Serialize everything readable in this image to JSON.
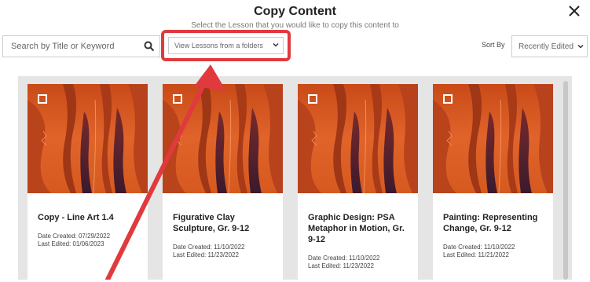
{
  "dialog": {
    "title": "Copy Content",
    "subtitle": "Select the Lesson that you would like to copy this content to"
  },
  "search": {
    "placeholder": "Search by Title or Keyword"
  },
  "folder_select": {
    "value": "View Lessons from a folders"
  },
  "sort": {
    "label": "Sort By",
    "value": "Recently Edited"
  },
  "colors": {
    "annotation_red": "#e03a3e",
    "panel_gray": "#e5e5e5",
    "painting_orange": "#d2571f"
  },
  "cards": [
    {
      "title": "Copy - Line Art 1.4",
      "created": "Date Created: 07/29/2022",
      "edited": "Last Edited: 01/06/2023"
    },
    {
      "title": "Figurative Clay Sculpture, Gr. 9-12",
      "created": "Date Created: 11/10/2022",
      "edited": "Last Edited: 11/23/2022"
    },
    {
      "title": "Graphic Design: PSA Metaphor in Motion, Gr. 9-12",
      "created": "Date Created: 11/10/2022",
      "edited": "Last Edited: 11/23/2022"
    },
    {
      "title": "Painting: Representing Change, Gr. 9-12",
      "created": "Date Created: 11/10/2022",
      "edited": "Last Edited: 11/21/2022"
    }
  ]
}
